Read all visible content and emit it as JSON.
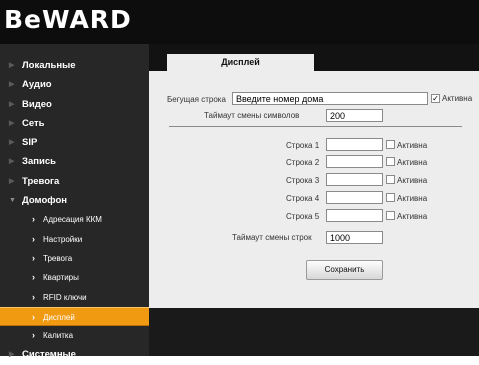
{
  "brand": {
    "logo": "BeWARD"
  },
  "sidebar": {
    "items": [
      {
        "label": "Локальные"
      },
      {
        "label": "Аудио"
      },
      {
        "label": "Видео"
      },
      {
        "label": "Сеть"
      },
      {
        "label": "SIP"
      },
      {
        "label": "Запись"
      },
      {
        "label": "Тревога"
      },
      {
        "label": "Домофон"
      }
    ],
    "subitems": [
      {
        "label": "Адресация ККМ"
      },
      {
        "label": "Настройки"
      },
      {
        "label": "Тревога"
      },
      {
        "label": "Квартиры"
      },
      {
        "label": "RFID ключи"
      },
      {
        "label": "Дисплей",
        "active": true
      },
      {
        "label": "Калитка"
      }
    ],
    "last_item": {
      "label": "Системные"
    }
  },
  "tab": {
    "label": "Дисплей"
  },
  "form": {
    "ticker_label": "Бегущая строка",
    "ticker_value": "Введите номер дома",
    "ticker_active_label": "Активна",
    "ticker_active_checked": true,
    "char_timeout_label": "Таймаут смены символов",
    "char_timeout_value": "200",
    "lines": [
      {
        "label": "Строка 1",
        "value": "",
        "active_label": "Активна",
        "checked": false
      },
      {
        "label": "Строка 2",
        "value": "",
        "active_label": "Активна",
        "checked": false
      },
      {
        "label": "Строка 3",
        "value": "",
        "active_label": "Активна",
        "checked": false
      },
      {
        "label": "Строка 4",
        "value": "",
        "active_label": "Активна",
        "checked": false
      },
      {
        "label": "Строка 5",
        "value": "",
        "active_label": "Активна",
        "checked": false
      }
    ],
    "line_timeout_label": "Таймаут смены строк",
    "line_timeout_value": "1000",
    "save_label": "Сохранить"
  },
  "colors": {
    "accent": "#f09a12",
    "sidebar_bg": "#272727",
    "content_bg": "#ededed"
  }
}
